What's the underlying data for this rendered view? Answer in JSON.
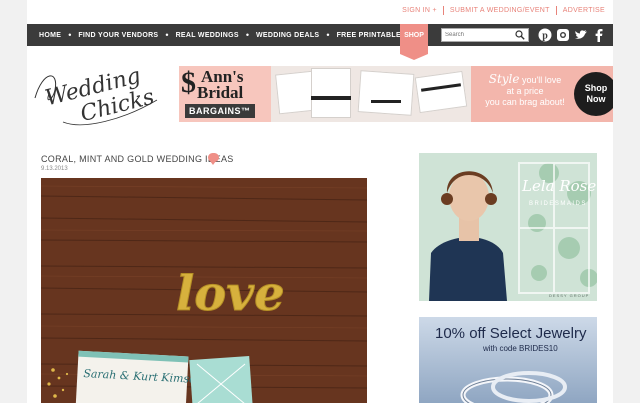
{
  "utility_links": [
    "SIGN IN +",
    "SUBMIT A WEDDING/EVENT",
    "ADVERTISE"
  ],
  "nav": {
    "items": [
      "HOME",
      "FIND YOUR VENDORS",
      "REAL WEDDINGS",
      "WEDDING DEALS",
      "FREE PRINTABLES"
    ],
    "shop_label": "SHOP",
    "search_placeholder": "Search",
    "social_icons": [
      "pinterest-icon",
      "instagram-icon",
      "twitter-icon",
      "facebook-icon"
    ]
  },
  "logo": {
    "line1": "Wedding",
    "line2": "Chicks"
  },
  "banner": {
    "brand_line1": "Ann's",
    "brand_line2": "Bridal",
    "bargains": "BARGAINS™",
    "style_word": "Style",
    "tagline_1": "you'll love",
    "tagline_2": "at a price",
    "tagline_3": "you can brag about!",
    "cta_line1": "Shop",
    "cta_line2": "Now"
  },
  "post": {
    "title": "CORAL, MINT AND GOLD WEDDING IDEAS",
    "date": "9.13.2013",
    "love_word": "love",
    "card_names": "Sarah & Kurt Kimsey"
  },
  "sidebar": {
    "ad1": {
      "brand": "Lela Rose",
      "sub": "BRIDESMAIDS",
      "footer": "DESSY GROUP"
    },
    "ad2": {
      "headline": "10% off Select Jewelry",
      "code_line": "with code BRIDES10"
    }
  },
  "colors": {
    "accent": "#ef8f87",
    "nav_bg": "#3b3b3b",
    "link": "#e8837a"
  }
}
